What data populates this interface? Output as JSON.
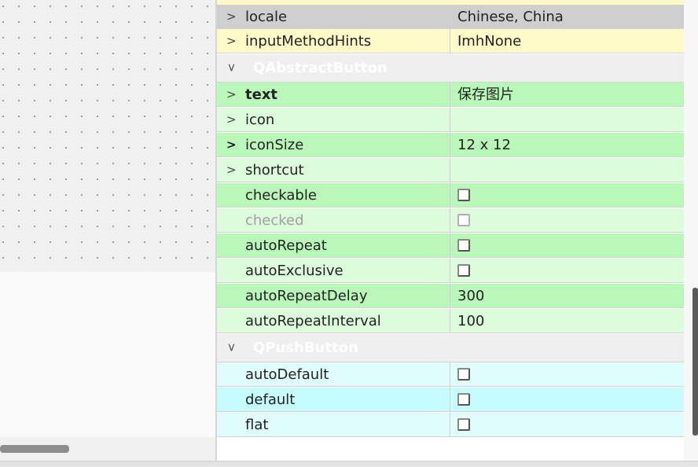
{
  "properties_top": [
    {
      "name": "locale",
      "value": "Chinese, China"
    },
    {
      "name": "inputMethodHints",
      "value": "ImhNone"
    }
  ],
  "groups": [
    {
      "title": "QAbstractButton",
      "rows": [
        {
          "name": "text",
          "value": "保存图片"
        },
        {
          "name": "icon",
          "value": ""
        },
        {
          "name": "iconSize",
          "value": "12 x 12"
        },
        {
          "name": "shortcut",
          "value": ""
        },
        {
          "name": "checkable",
          "checked": false
        },
        {
          "name": "checked",
          "checked": false
        },
        {
          "name": "autoRepeat",
          "checked": false
        },
        {
          "name": "autoExclusive",
          "checked": false
        },
        {
          "name": "autoRepeatDelay",
          "value": "300"
        },
        {
          "name": "autoRepeatInterval",
          "value": "100"
        }
      ]
    },
    {
      "title": "QPushButton",
      "rows": [
        {
          "name": "autoDefault",
          "checked": false
        },
        {
          "name": "default",
          "checked": false
        },
        {
          "name": "flat",
          "checked": false
        }
      ]
    }
  ],
  "colors": {
    "selected_row": "#cfcfcf",
    "qwidget_row": "#fffac8",
    "abstractbutton_strong": "#baf8ba",
    "abstractbutton_light": "#dcfcdc",
    "pushbutton_light": "#e0fcfc",
    "pushbutton_strong": "#c6fcfc"
  }
}
